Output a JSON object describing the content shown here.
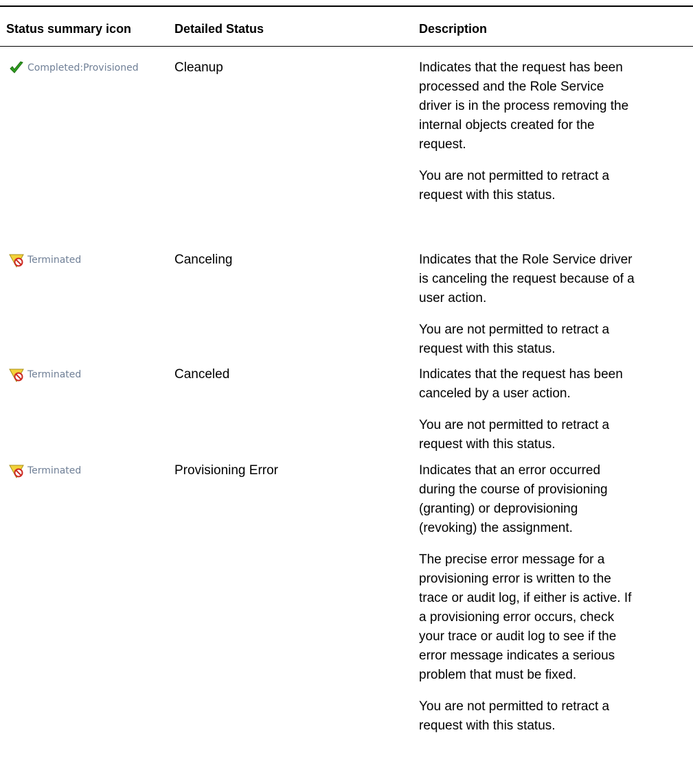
{
  "table": {
    "headers": {
      "status_icon": "Status summary icon",
      "detailed_status": "Detailed Status",
      "description": "Description"
    },
    "rows": [
      {
        "status_icon": "check-icon",
        "status_label": "Completed:Provisioned",
        "detailed_status": "Cleanup",
        "desc_p1_lines": [
          "Indicates that the request has been",
          "processed and the Role Service",
          "driver is in the process removing the",
          "internal objects created for the",
          "request."
        ],
        "desc_p2_lines": [
          "You are not permitted to retract a",
          "request with this status."
        ]
      },
      {
        "status_icon": "terminated-icon",
        "status_label": "Terminated",
        "detailed_status": "Canceling",
        "desc_p1_lines": [
          "Indicates that the Role Service driver",
          "is canceling the request because of a",
          "user action."
        ],
        "desc_p2_lines": [
          "You are not permitted to retract a",
          "request with this status."
        ]
      },
      {
        "status_icon": "terminated-icon",
        "status_label": "Terminated",
        "detailed_status": "Canceled",
        "desc_p1_lines": [
          "Indicates that the request has been",
          "canceled by a user action."
        ],
        "desc_p2_lines": [
          "You are not permitted to retract a",
          "request with this status."
        ]
      },
      {
        "status_icon": "terminated-icon",
        "status_label": "Terminated",
        "detailed_status": "Provisioning Error",
        "desc_p1_lines": [
          "Indicates that an error occurred",
          "during the course of provisioning",
          "(granting) or deprovisioning",
          "(revoking) the assignment."
        ],
        "desc_p2_lines": [
          "The precise error message for a",
          "provisioning error is written to the",
          "trace or audit log, if either is active. If",
          "a provisioning error occurs, check",
          "your trace or audit log to see if the",
          "error message indicates a serious",
          "problem that must be fixed."
        ],
        "desc_p3_lines": [
          "You are not permitted to retract a",
          "request with this status."
        ]
      }
    ]
  },
  "colors": {
    "status_label": "#6f7f96",
    "check_green": "#2e9e1f",
    "warning_yellow": "#f3d23a",
    "prohibit_red": "#cc2a22"
  }
}
